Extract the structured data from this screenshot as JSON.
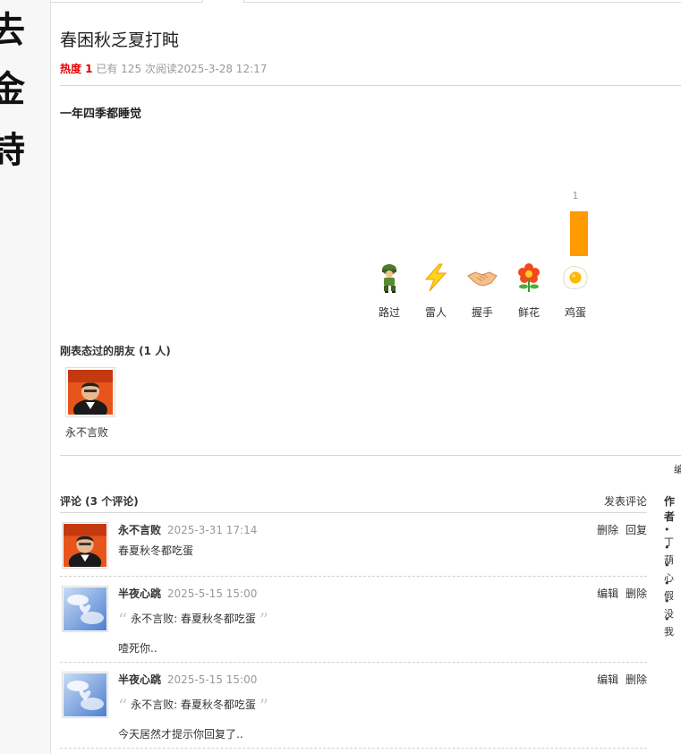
{
  "calligraphy": [
    "去",
    "金",
    "詩"
  ],
  "post": {
    "title": "春困秋乏夏打盹",
    "hot_label": "热度 1",
    "meta_text": "已有 125 次阅读2025-3-28 12:17",
    "content": "一年四季都睡觉"
  },
  "reactions": [
    {
      "label": "路过",
      "count": "",
      "value": 0,
      "icon": "soldier-icon"
    },
    {
      "label": "雷人",
      "count": "",
      "value": 0,
      "icon": "lightning-icon"
    },
    {
      "label": "握手",
      "count": "",
      "value": 0,
      "icon": "handshake-icon"
    },
    {
      "label": "鲜花",
      "count": "",
      "value": 0,
      "icon": "flower-icon"
    },
    {
      "label": "鸡蛋",
      "count": "1",
      "value": 1,
      "icon": "egg-icon"
    }
  ],
  "friends": {
    "title": "刚表态过的朋友 (1 人)",
    "list": [
      {
        "name": "永不言败"
      }
    ]
  },
  "cut_edit": "编",
  "comments": {
    "title": "评论 (3 个评论)",
    "post_label": "发表评论",
    "items": [
      {
        "name": "永不言败",
        "time": "2025-3-31 17:14",
        "actions": [
          "删除",
          "回复"
        ],
        "quote": "",
        "text": "春夏秋冬都吃蛋"
      },
      {
        "name": "半夜心跳",
        "time": "2025-5-15 15:00",
        "actions": [
          "编辑",
          "删除"
        ],
        "quote": "永不言败: 春夏秋冬都吃蛋",
        "text": "噎死你.."
      },
      {
        "name": "半夜心跳",
        "time": "2025-5-15 15:00",
        "actions": [
          "编辑",
          "删除"
        ],
        "quote": "永不言败: 春夏秋冬都吃蛋",
        "text": "今天居然才提示你回复了.."
      }
    ]
  },
  "side": {
    "title": "作者",
    "items": [
      "丁",
      "葫",
      "心",
      "假",
      "没",
      "我"
    ]
  },
  "colors": {
    "hot": "#e30000",
    "bar": "#ff9a00",
    "divider": "#d6d6d6"
  }
}
